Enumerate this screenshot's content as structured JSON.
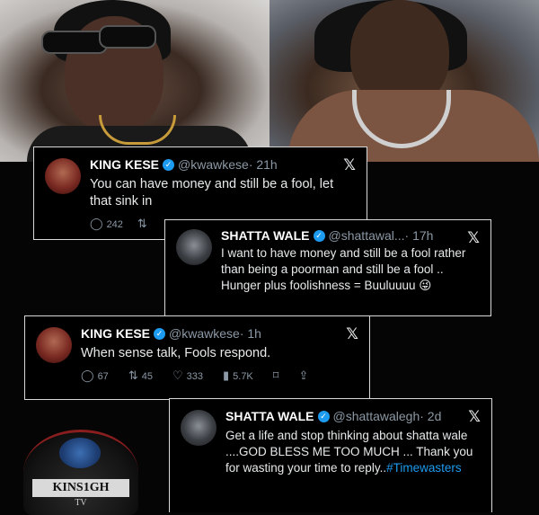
{
  "colors": {
    "background": "#050505",
    "tweet_border": "#d9d9d9",
    "verified": "#1d9bf0",
    "hashtag": "#1d9bf0",
    "muted": "#8b98a5"
  },
  "icons": {
    "close": "x-logo-icon",
    "verified": "verified-badge-icon",
    "reply": "reply-icon",
    "retweet": "retweet-icon",
    "like": "like-icon",
    "views": "views-icon",
    "bookmark": "bookmark-icon",
    "share": "share-icon"
  },
  "tweets": [
    {
      "name": "KING KESE",
      "handle": "@kwawkese",
      "time": "· 21h",
      "text": "You can have money and still be a fool, let that sink in",
      "replies": "242",
      "retweets": ""
    },
    {
      "name": "SHATTA WALE",
      "handle": "@shattawal...",
      "time": "· 17h",
      "text": "I want to have money and still  be a fool rather than being a poorman and still be a fool ..\nHunger plus foolishness = Buuluuuu",
      "emoji": "😜"
    },
    {
      "name": "KING KESE",
      "handle": "@kwawkese",
      "time": "· 1h",
      "text": "When sense talk, Fools respond.",
      "replies": "67",
      "retweets": "45",
      "likes": "333",
      "views": "5.7K"
    },
    {
      "name": "SHATTA WALE",
      "handle": "@shattawalegh",
      "time": "· 2d",
      "text": "Get a life and stop thinking about shatta wale ....GOD BLESS ME TOO MUCH ... Thank you for wasting your time to reply..",
      "hashtag": "#Timewasters"
    }
  ],
  "watermark": {
    "title": "KINS1GH",
    "sub": "TV"
  }
}
